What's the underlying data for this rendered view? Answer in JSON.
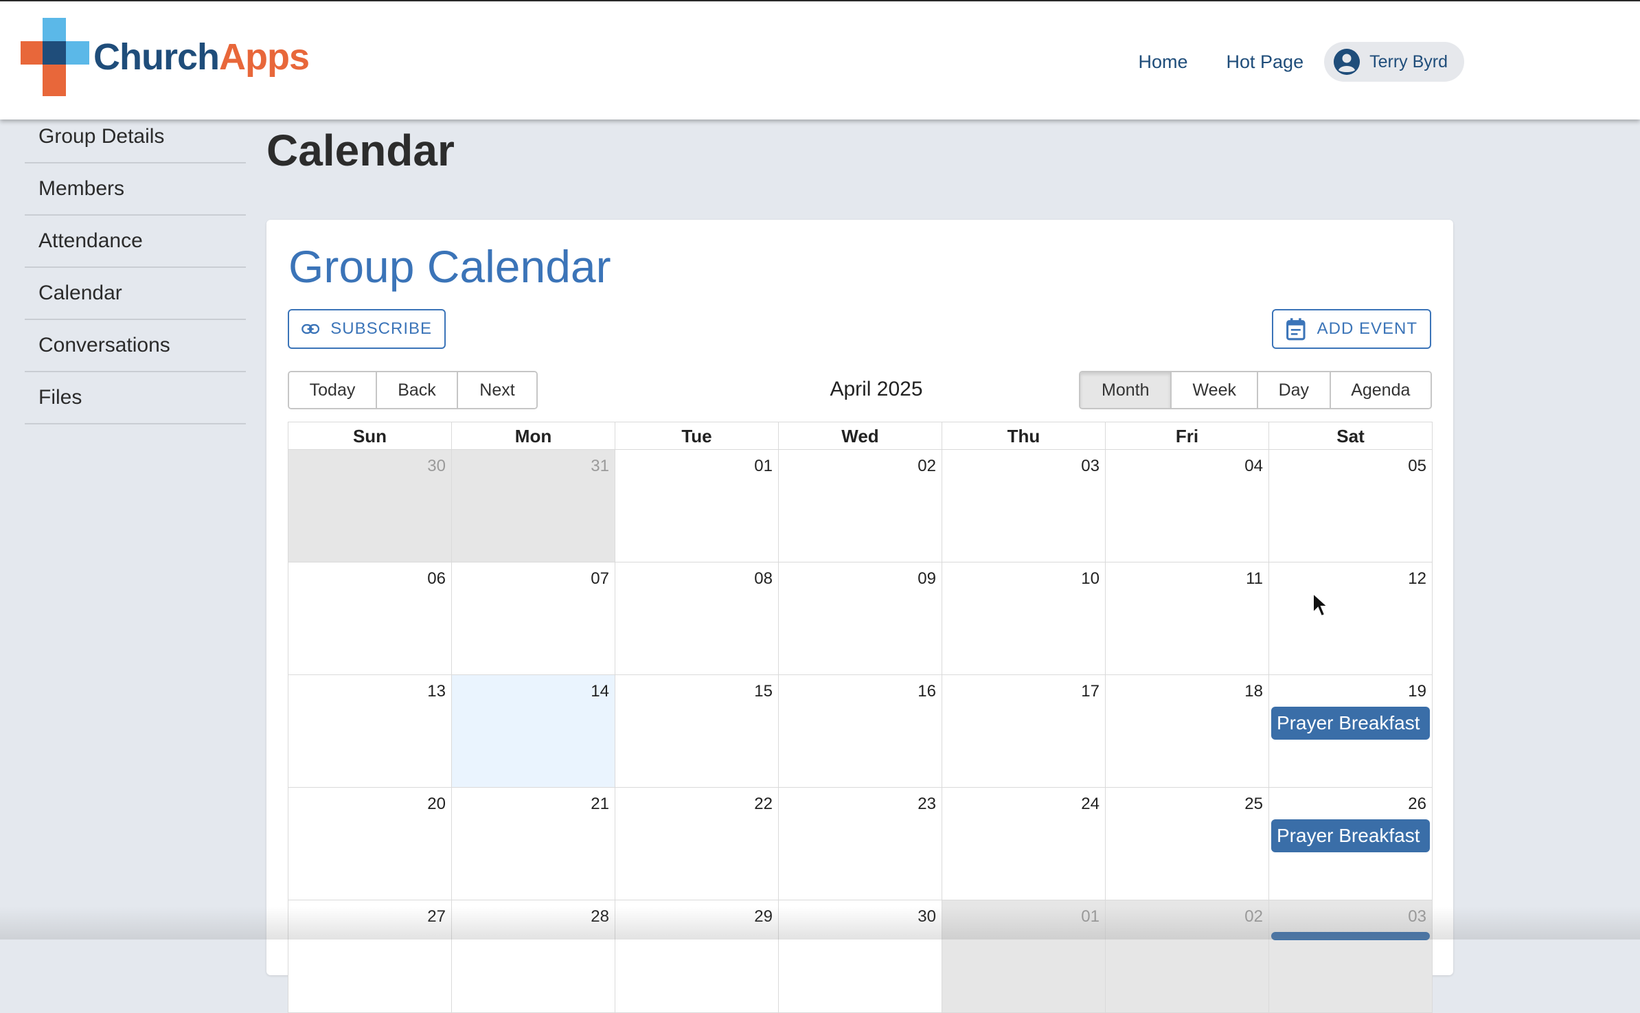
{
  "header": {
    "logo": {
      "part1": "Church",
      "part2": "Apps"
    },
    "nav": [
      {
        "label": "Home"
      },
      {
        "label": "Hot Page"
      }
    ],
    "user": {
      "name": "Terry Byrd",
      "icon": "account-circle-icon"
    }
  },
  "sidebar": {
    "items": [
      {
        "label": "Group Details"
      },
      {
        "label": "Members"
      },
      {
        "label": "Attendance"
      },
      {
        "label": "Calendar"
      },
      {
        "label": "Conversations"
      },
      {
        "label": "Files"
      }
    ]
  },
  "page": {
    "title": "Calendar"
  },
  "card": {
    "title": "Group Calendar",
    "subscribe_label": "SUBSCRIBE",
    "add_event_label": "ADD EVENT"
  },
  "toolbar": {
    "nav_buttons": [
      "Today",
      "Back",
      "Next"
    ],
    "month_label": "April 2025",
    "views": [
      "Month",
      "Week",
      "Day",
      "Agenda"
    ],
    "active_view": "Month"
  },
  "calendar": {
    "weekdays": [
      "Sun",
      "Mon",
      "Tue",
      "Wed",
      "Thu",
      "Fri",
      "Sat"
    ],
    "weeks": [
      [
        {
          "d": "30",
          "off": true
        },
        {
          "d": "31",
          "off": true
        },
        {
          "d": "01"
        },
        {
          "d": "02"
        },
        {
          "d": "03"
        },
        {
          "d": "04"
        },
        {
          "d": "05"
        }
      ],
      [
        {
          "d": "06"
        },
        {
          "d": "07"
        },
        {
          "d": "08"
        },
        {
          "d": "09"
        },
        {
          "d": "10"
        },
        {
          "d": "11"
        },
        {
          "d": "12"
        }
      ],
      [
        {
          "d": "13"
        },
        {
          "d": "14",
          "today": true
        },
        {
          "d": "15"
        },
        {
          "d": "16"
        },
        {
          "d": "17"
        },
        {
          "d": "18"
        },
        {
          "d": "19",
          "event": "Prayer Breakfast"
        }
      ],
      [
        {
          "d": "20"
        },
        {
          "d": "21"
        },
        {
          "d": "22"
        },
        {
          "d": "23"
        },
        {
          "d": "24"
        },
        {
          "d": "25"
        },
        {
          "d": "26",
          "event": "Prayer Breakfast"
        }
      ],
      [
        {
          "d": "27"
        },
        {
          "d": "28"
        },
        {
          "d": "29"
        },
        {
          "d": "30"
        },
        {
          "d": "01",
          "off": true
        },
        {
          "d": "02",
          "off": true
        },
        {
          "d": "03",
          "off": true,
          "event": "Prayer Breakfast"
        }
      ]
    ]
  },
  "colors": {
    "brand_blue": "#1f4d7a",
    "brand_orange": "#e8673a",
    "accent": "#3b74b8",
    "event": "#3a6ea8",
    "today_bg": "#eaf4fe"
  }
}
